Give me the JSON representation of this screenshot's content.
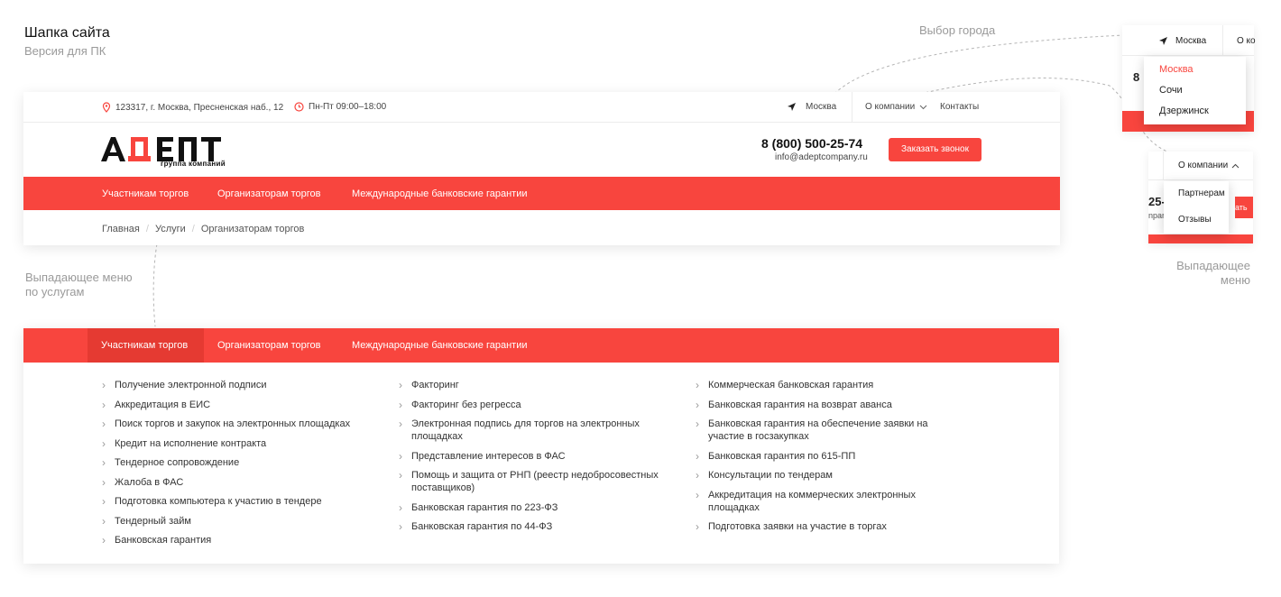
{
  "page": {
    "title": "Шапка сайта",
    "subtitle": "Версия для ПК"
  },
  "notes": {
    "city_select": "Выбор города",
    "services_dropdown": "Выпадающее меню по услугам",
    "about_dropdown": "Выпадающее меню"
  },
  "topbar": {
    "address": "123317, г. Москва, Пресненская наб., 12",
    "hours": "Пн-Пт 09:00–18:00",
    "city": "Москва",
    "about": "О компании",
    "contacts": "Контакты"
  },
  "header": {
    "logo_text": "АДЕПТ",
    "logo_sub": "группа компаний",
    "phone": "8 (800) 500-25-74",
    "email": "info@adeptcompany.ru",
    "callback_button": "Заказать звонок"
  },
  "nav": {
    "items": [
      "Участникам торгов",
      "Организаторам торгов",
      "Международные банковские гарантии"
    ]
  },
  "breadcrumbs": [
    "Главная",
    "Услуги",
    "Организаторам торгов"
  ],
  "mega_menu": {
    "col1": [
      "Получение электронной подписи",
      "Аккредитация в ЕИС",
      "Поиск торгов и закупок на электронных площадках",
      "Кредит на исполнение контракта",
      "Тендерное сопровождение",
      "Жалоба в ФАС",
      "Подготовка компьютера к участию в тендере",
      "Тендерный займ",
      "Банковская гарантия"
    ],
    "col2": [
      "Факторинг",
      "Факторинг без регресса",
      "Электронная подпись для торгов на электронных площадках",
      "Представление интересов в ФАС",
      "Помощь и защита от РНП (реестр недобросовестных поставщиков)",
      "Банковская гарантия по 223-ФЗ",
      "Банковская гарантия по 44-ФЗ"
    ],
    "col3": [
      "Коммерческая банковская гарантия",
      "Банковская гарантия на возврат аванса",
      "Банковская гарантия на обеспечение заявки на участие в госзакупках",
      "Банковская гарантия по 615-ПП",
      "Консультации по тендерам",
      "Аккредитация на коммерческих электронных площадках",
      "Подготовка заявки на участие в торгах"
    ]
  },
  "city_dropdown": {
    "current": "Москва",
    "next_tab": "О ко",
    "cities": [
      "Москва",
      "Сочи",
      "Дзержинск"
    ],
    "clip_text": "8"
  },
  "about_dropdown": {
    "label": "О компании",
    "items": [
      "Партнерам",
      "Отзывы"
    ],
    "clip_phone": "25-",
    "clip_label": "npar",
    "clip_btn": "ать"
  },
  "colors": {
    "accent": "#f8453e",
    "accent_dark": "#e53a32"
  }
}
